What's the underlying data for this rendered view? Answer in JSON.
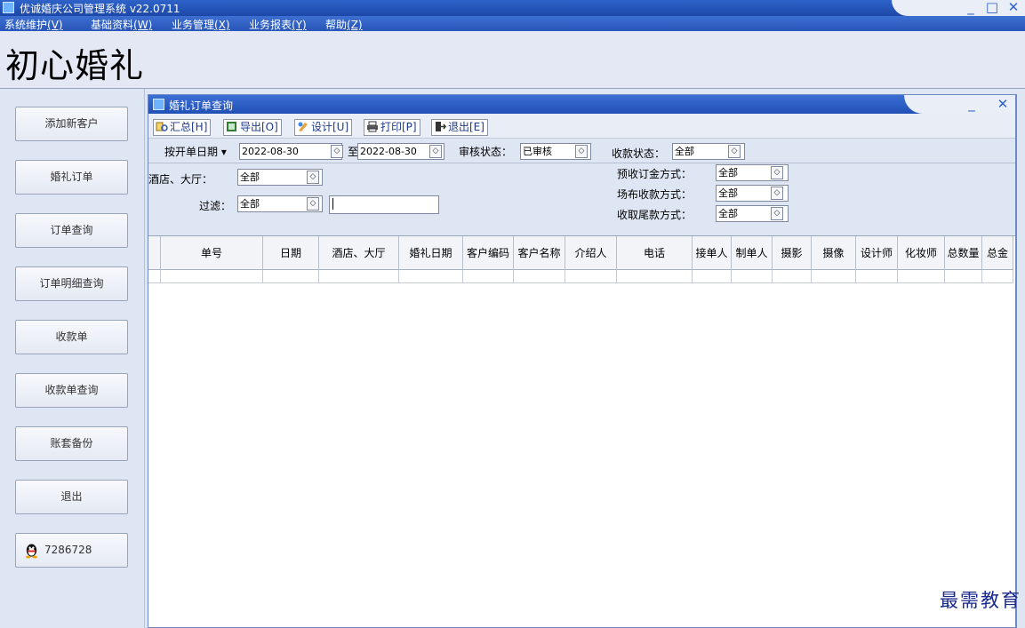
{
  "app": {
    "title": "优诚婚庆公司管理系统  v22.0711"
  },
  "menu": [
    {
      "label": "系统维护",
      "key": "(V)"
    },
    {
      "label": "基础资料",
      "key": "(W)"
    },
    {
      "label": "业务管理",
      "key": "(X)"
    },
    {
      "label": "业务报表",
      "key": "(Y)"
    },
    {
      "label": "帮助",
      "key": "(Z)"
    }
  ],
  "brand": {
    "title": "初心婚礼"
  },
  "sidebar": {
    "items": [
      {
        "label": "添加新客户"
      },
      {
        "label": "婚礼订单"
      },
      {
        "label": "订单查询"
      },
      {
        "label": "订单明细查询"
      },
      {
        "label": "收款单"
      },
      {
        "label": "收款单查询"
      },
      {
        "label": "账套备份"
      },
      {
        "label": "退出"
      }
    ],
    "qq": {
      "number": "7286728"
    }
  },
  "window": {
    "title": "婚礼订单查询",
    "toolbar": [
      {
        "label": "汇总[H]",
        "icon": "summary-icon"
      },
      {
        "label": "导出[O]",
        "icon": "export-icon"
      },
      {
        "label": "设计[U]",
        "icon": "design-icon"
      },
      {
        "label": "打印[P]",
        "icon": "print-icon"
      },
      {
        "label": "退出[E]",
        "icon": "exit-icon"
      }
    ],
    "filters": {
      "date_mode": "按开单日期",
      "date_from": "2022-08-30",
      "to_label": "至",
      "date_to": "2022-08-30",
      "audit_label": "审核状态：",
      "audit_value": "已审核",
      "payment_label": "收款状态：",
      "payment_value": "全部",
      "hotel_label": "酒店、大厅：",
      "hotel_value": "全部",
      "filter_label": "过滤：",
      "filter_value": "全部",
      "filter_text": "",
      "deposit_label": "预收订金方式：",
      "deposit_value": "全部",
      "venue_label": "场布收款方式：",
      "venue_value": "全部",
      "final_label": "收取尾款方式：",
      "final_value": "全部"
    },
    "table": {
      "columns": [
        "单号",
        "日期",
        "酒店、大厅",
        "婚礼日期",
        "客户编码",
        "客户名称",
        "介绍人",
        "电话",
        "接单人",
        "制单人",
        "摄影",
        "摄像",
        "设计师",
        "化妆师",
        "总数量",
        "总金"
      ],
      "rows": []
    }
  },
  "watermark": "最需教育"
}
